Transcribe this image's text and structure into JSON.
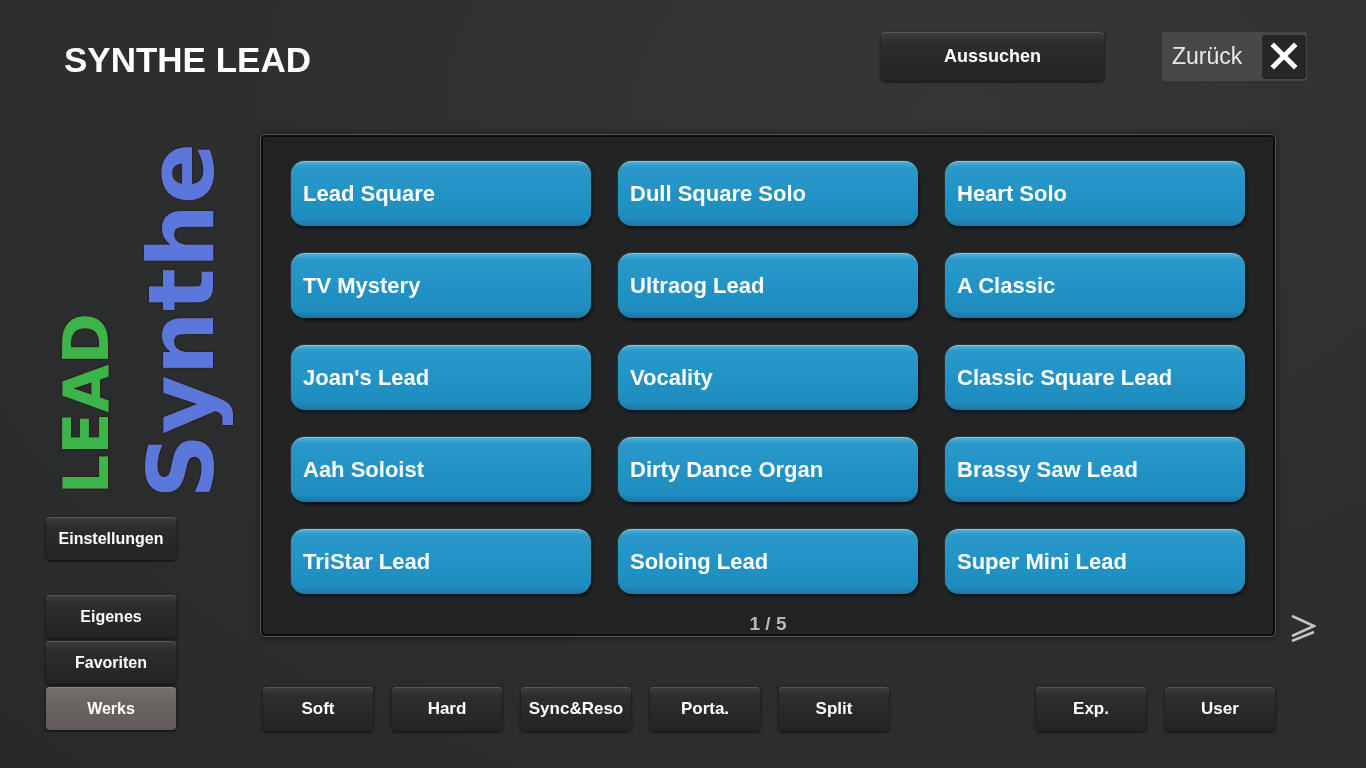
{
  "header": {
    "title": "SYNTHE LEAD",
    "search_button": "Aussuchen",
    "back_button": "Zurück"
  },
  "logo": [
    {
      "text": "Synthe",
      "color": "#5a78dc"
    },
    {
      "text": "LEAD",
      "color": "#3bb54a"
    }
  ],
  "sidebar": {
    "settings_button": "Einstellungen",
    "categories": [
      {
        "label": "Eigenes",
        "selected": false
      },
      {
        "label": "Favoriten",
        "selected": false
      },
      {
        "label": "Werks",
        "selected": true
      }
    ]
  },
  "sounds": [
    {
      "label": "Lead Square"
    },
    {
      "label": "Dull Square Solo"
    },
    {
      "label": "Heart Solo"
    },
    {
      "label": "TV Mystery"
    },
    {
      "label": "Ultraog Lead"
    },
    {
      "label": "A Classic"
    },
    {
      "label": "Joan's Lead"
    },
    {
      "label": "Vocality"
    },
    {
      "label": "Classic Square Lead"
    },
    {
      "label": "Aah Soloist"
    },
    {
      "label": "Dirty Dance Organ"
    },
    {
      "label": "Brassy Saw Lead"
    },
    {
      "label": "TriStar Lead"
    },
    {
      "label": "Soloing Lead"
    },
    {
      "label": "Super Mini Lead"
    }
  ],
  "page_indicator": "1 / 5",
  "filter_buttons": [
    {
      "label": "Soft"
    },
    {
      "label": "Hard"
    },
    {
      "label": "Sync&Reso"
    },
    {
      "label": "Porta."
    },
    {
      "label": "Split"
    }
  ],
  "extra_buttons": [
    {
      "label": "Exp."
    },
    {
      "label": "User"
    }
  ]
}
